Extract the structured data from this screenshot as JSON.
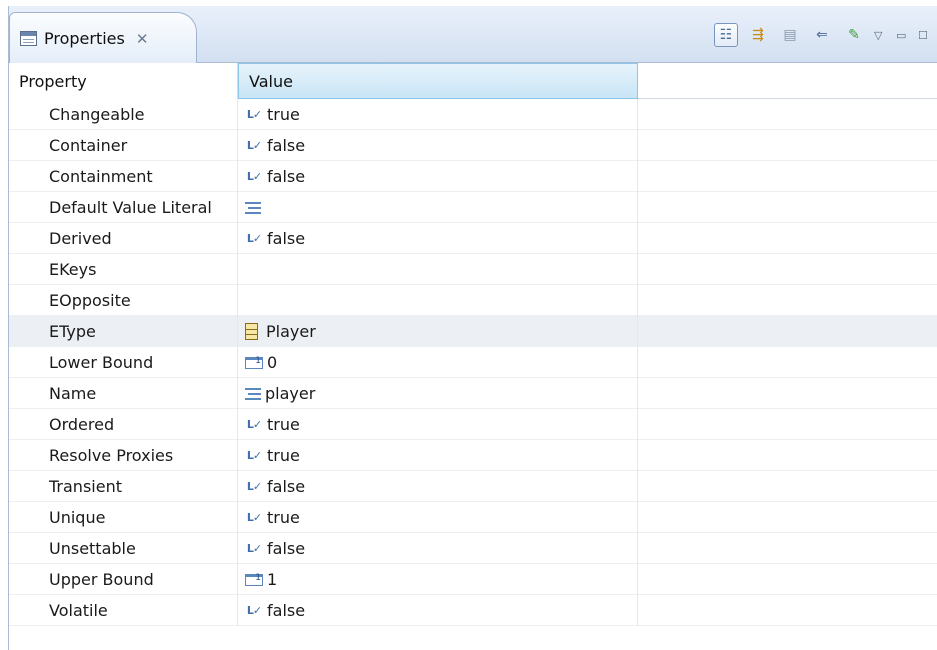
{
  "tab": {
    "title": "Properties",
    "close_glyph": "✕"
  },
  "toolbar": {
    "buttons": [
      {
        "name": "show-categories-icon",
        "glyph": "☷"
      },
      {
        "name": "show-advanced-icon",
        "glyph": "⇶"
      },
      {
        "name": "filter-icon",
        "glyph": "▤"
      },
      {
        "name": "restore-default-icon",
        "glyph": "⇐"
      },
      {
        "name": "pin-icon",
        "glyph": "✎"
      }
    ],
    "menu_glyph": "▽",
    "minimize_glyph": "▭",
    "maximize_glyph": "☐"
  },
  "table": {
    "headers": {
      "property": "Property",
      "value": "Value"
    },
    "rows": [
      {
        "property": "Changeable",
        "value": "true",
        "icon": "bool"
      },
      {
        "property": "Container",
        "value": "false",
        "icon": "bool"
      },
      {
        "property": "Containment",
        "value": "false",
        "icon": "bool"
      },
      {
        "property": "Default Value Literal",
        "value": "",
        "icon": "text"
      },
      {
        "property": "Derived",
        "value": "false",
        "icon": "bool"
      },
      {
        "property": "EKeys",
        "value": "",
        "icon": ""
      },
      {
        "property": "EOpposite",
        "value": "",
        "icon": ""
      },
      {
        "property": "EType",
        "value": "Player",
        "icon": "class"
      },
      {
        "property": "Lower Bound",
        "value": "0",
        "icon": "int"
      },
      {
        "property": "Name",
        "value": "player",
        "icon": "text"
      },
      {
        "property": "Ordered",
        "value": "true",
        "icon": "bool"
      },
      {
        "property": "Resolve Proxies",
        "value": "true",
        "icon": "bool"
      },
      {
        "property": "Transient",
        "value": "false",
        "icon": "bool"
      },
      {
        "property": "Unique",
        "value": "true",
        "icon": "bool"
      },
      {
        "property": "Unsettable",
        "value": "false",
        "icon": "bool"
      },
      {
        "property": "Upper Bound",
        "value": "1",
        "icon": "int"
      },
      {
        "property": "Volatile",
        "value": "false",
        "icon": "bool"
      }
    ],
    "selected_row": "EType"
  }
}
